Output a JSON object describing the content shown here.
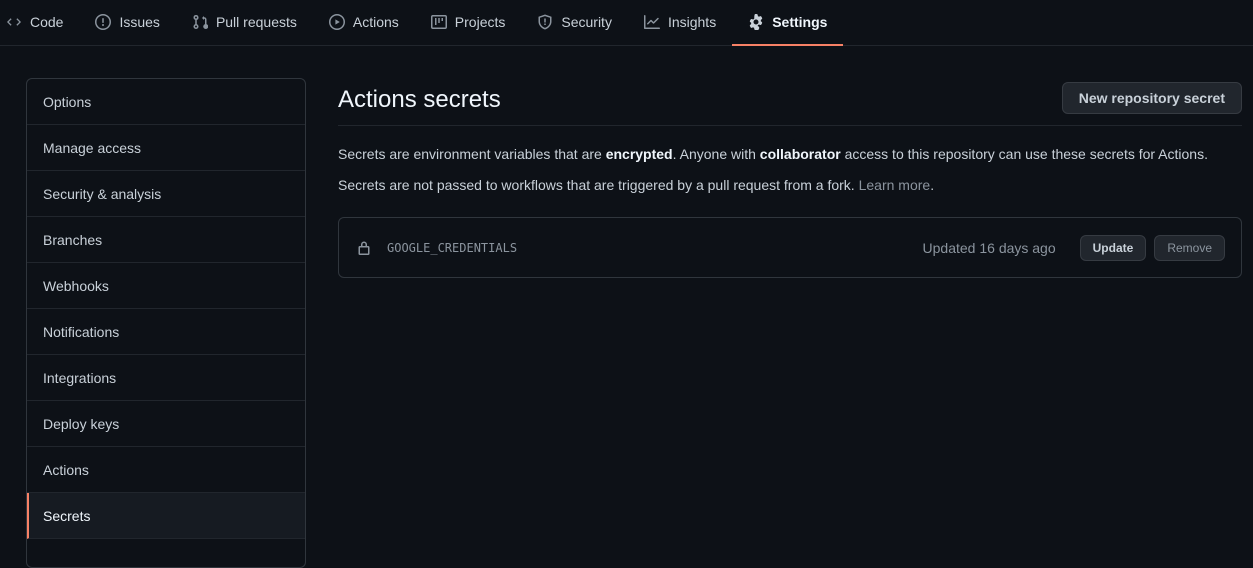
{
  "tabs": [
    {
      "label": "Code",
      "icon": "code-icon"
    },
    {
      "label": "Issues",
      "icon": "issue-icon"
    },
    {
      "label": "Pull requests",
      "icon": "pull-request-icon"
    },
    {
      "label": "Actions",
      "icon": "play-icon"
    },
    {
      "label": "Projects",
      "icon": "project-icon"
    },
    {
      "label": "Security",
      "icon": "shield-icon"
    },
    {
      "label": "Insights",
      "icon": "graph-icon"
    },
    {
      "label": "Settings",
      "icon": "gear-icon",
      "selected": true
    }
  ],
  "sidebar": {
    "items": [
      {
        "label": "Options"
      },
      {
        "label": "Manage access"
      },
      {
        "label": "Security & analysis"
      },
      {
        "label": "Branches"
      },
      {
        "label": "Webhooks"
      },
      {
        "label": "Notifications"
      },
      {
        "label": "Integrations"
      },
      {
        "label": "Deploy keys"
      },
      {
        "label": "Actions"
      },
      {
        "label": "Secrets",
        "selected": true
      }
    ]
  },
  "main": {
    "title": "Actions secrets",
    "new_button": "New repository secret",
    "desc1": {
      "pre": "Secrets are environment variables that are ",
      "bold1": "encrypted",
      "mid": ". Anyone with ",
      "bold2": "collaborator",
      "post": " access to this repository can use these secrets for Actions."
    },
    "desc2": {
      "text": "Secrets are not passed to workflows that are triggered by a pull request from a fork. ",
      "link": "Learn more",
      "end": "."
    },
    "secrets": [
      {
        "name": "GOOGLE_CREDENTIALS",
        "updated": "Updated 16 days ago",
        "update_label": "Update",
        "remove_label": "Remove",
        "icon": "lock-icon"
      }
    ]
  },
  "colors": {
    "background": "#0d1117",
    "accent_underline": "#f78166",
    "border": "#30363d"
  }
}
